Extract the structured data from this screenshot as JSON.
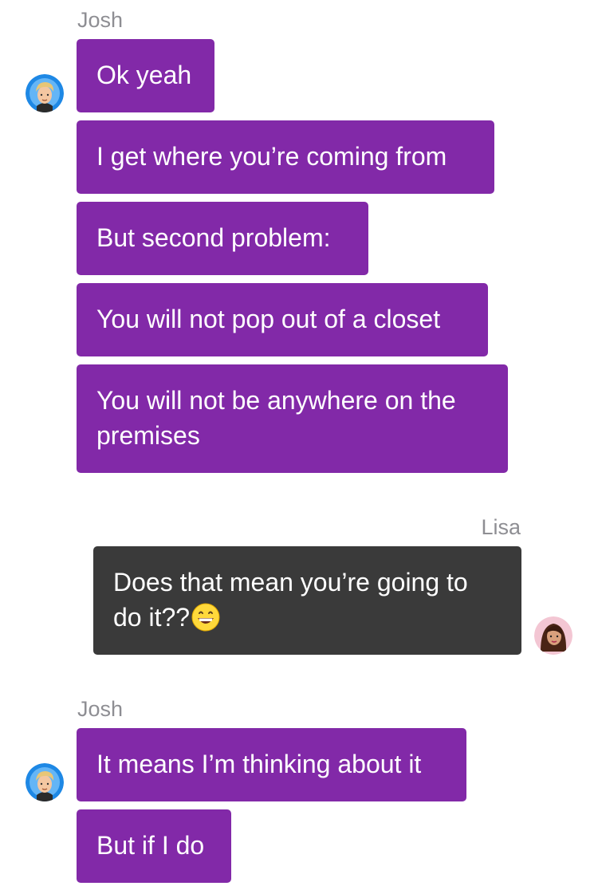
{
  "conversation": {
    "group1": {
      "sender": "Josh",
      "messages": [
        "Ok yeah",
        "I get where you’re coming from",
        "But second problem:",
        "You will not pop out of a closet",
        "You will not be anywhere on the",
        "premises"
      ]
    },
    "group2": {
      "sender": "Lisa",
      "messages": [
        "Does that mean you’re going to",
        "do it??"
      ],
      "emoji": "grinning-face-emoji"
    },
    "group3": {
      "sender": "Josh",
      "messages": [
        "It means I’m thinking about it",
        "But if I do"
      ]
    }
  },
  "colors": {
    "josh_bubble": "#8229a8",
    "lisa_bubble": "#3a3a3a",
    "sender_label": "#8e8e93",
    "text": "#ffffff"
  },
  "icons": {
    "josh_avatar": "josh-avatar",
    "lisa_avatar": "lisa-avatar"
  }
}
